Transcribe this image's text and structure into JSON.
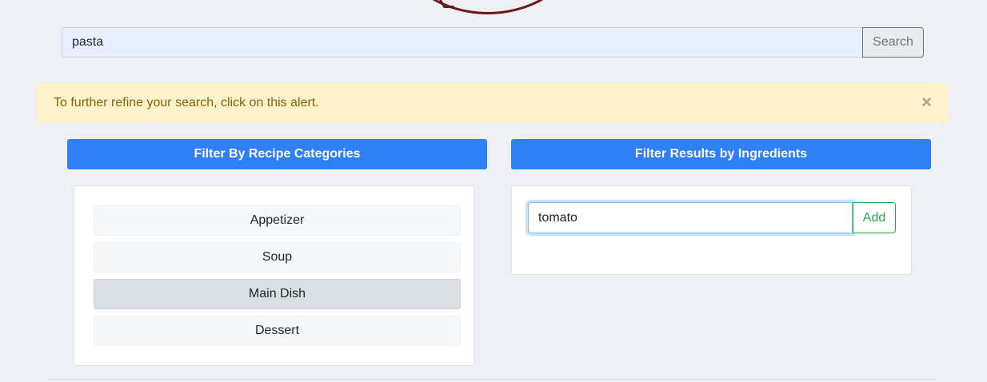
{
  "search": {
    "value": "pasta",
    "button_label": "Search"
  },
  "alert": {
    "text": "To further refine your search, click on this alert.",
    "close_glyph": "×"
  },
  "filters": {
    "categories_label": "Filter By Recipe Categories",
    "ingredients_label": "Filter Results by Ingredients"
  },
  "categories": [
    {
      "label": "Appetizer",
      "selected": false
    },
    {
      "label": "Soup",
      "selected": false
    },
    {
      "label": "Main Dish",
      "selected": true
    },
    {
      "label": "Dessert",
      "selected": false
    }
  ],
  "ingredients": {
    "input_value": "tomato",
    "add_label": "Add"
  },
  "colors": {
    "primary": "#2f7ff6",
    "alert_bg": "#fff3cd",
    "alert_text": "#856404",
    "success": "#28a745",
    "logo": "#6b1a1a"
  }
}
